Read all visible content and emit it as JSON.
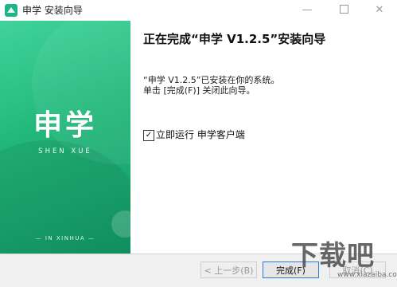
{
  "window": {
    "title": "申学 安装向导",
    "controls": {
      "minimize": "—",
      "close": "✕"
    }
  },
  "banner": {
    "brand_cn": "申学",
    "brand_en": "SHEN XUE",
    "footer": "— IN XINHUA —"
  },
  "content": {
    "heading": "正在完成“申学 V1.2.5”安装向导",
    "message_line1": "“申学 V1.2.5”已安装在你的系统。",
    "message_line2": "单击 [完成(F)] 关闭此向导。",
    "run_now_checkbox": {
      "checked": true,
      "mark": "✓",
      "label": "立即运行 申学客户端"
    }
  },
  "buttons": {
    "back": "< 上一步(B)",
    "finish": "完成(F)",
    "cancel": "取消(C)"
  },
  "watermark": {
    "text": "下载吧",
    "url": "www.xiazaiba.com"
  },
  "colors": {
    "banner_top": "#3fd39a",
    "banner_bottom": "#129a66",
    "accent_button_border": "#2b7bd6"
  }
}
